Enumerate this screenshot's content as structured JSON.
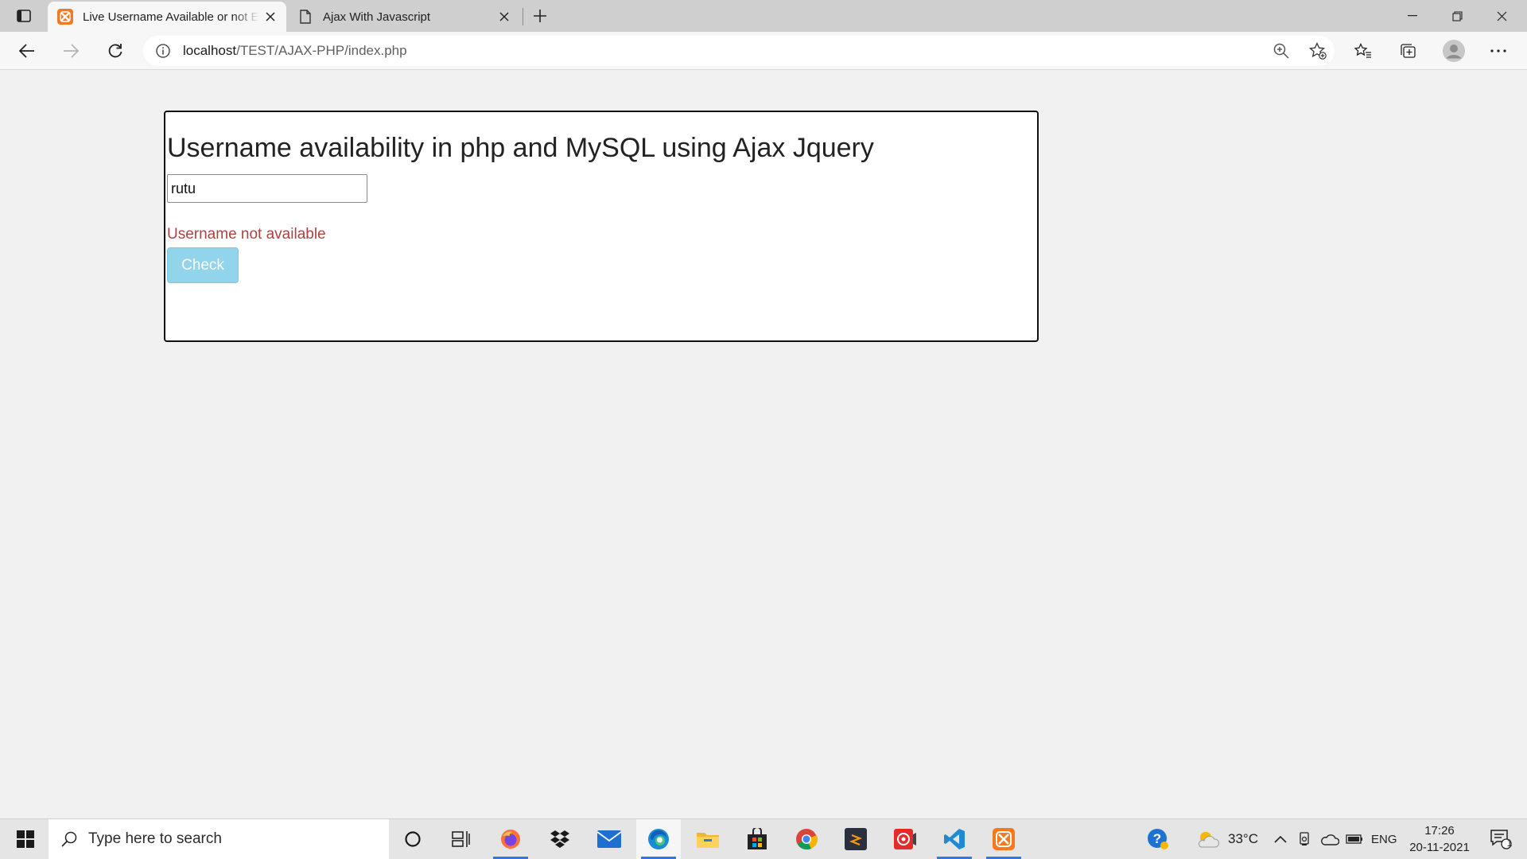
{
  "browser": {
    "tabs": [
      {
        "title": "Live Username Available or not Exam",
        "favicon": "xampp-icon",
        "active": true
      },
      {
        "title": "Ajax With Javascript",
        "favicon": "page-icon",
        "active": false
      }
    ],
    "address": {
      "host": "localhost",
      "path": "/TEST/AJAX-PHP/index.php"
    },
    "icons": {
      "tab_actions": "tab-actions-icon",
      "back": "back-arrow-icon",
      "forward": "forward-arrow-icon",
      "refresh": "refresh-icon",
      "info": "info-icon",
      "zoom": "zoom-icon",
      "add_favorite": "add-favorite-icon",
      "favorites": "favorites-icon",
      "collections": "collections-icon",
      "profile": "profile-avatar-icon",
      "menu": "more-menu-icon"
    }
  },
  "page": {
    "heading": "Username availability in php and MySQL using Ajax Jquery",
    "username_value": "rutu",
    "status_message": "Username not available",
    "check_button": "Check",
    "colors": {
      "status": "#a94442",
      "button": "#92d4ec",
      "border": "#111111"
    }
  },
  "taskbar": {
    "search_placeholder": "Type here to search",
    "apps": [
      "cortana-icon",
      "task-view-icon",
      "firefox-icon",
      "dropbox-icon",
      "mail-icon",
      "edge-icon",
      "file-explorer-icon",
      "store-icon",
      "chrome-icon",
      "sublime-icon",
      "screen-recorder-icon",
      "vscode-icon",
      "xampp-icon"
    ],
    "tray": {
      "help": "help-icon",
      "weather_temp": "33°C",
      "language": "ENG",
      "time": "17:26",
      "date": "20-11-2021",
      "notifications_count": "1"
    }
  }
}
